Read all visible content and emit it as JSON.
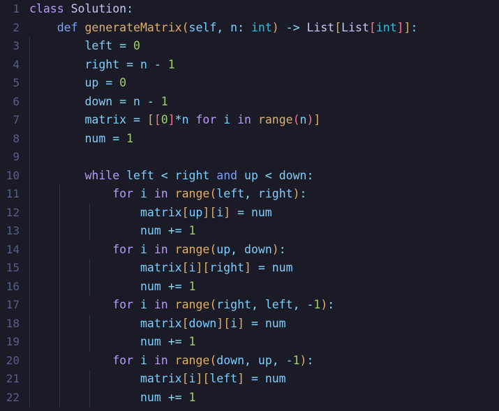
{
  "editor": {
    "language": "python",
    "font_size_px": 16.5,
    "line_height_px": 26.5,
    "active_line": 2,
    "indent_guide_x": [
      42,
      85,
      128,
      171
    ],
    "colors": {
      "background": "#1a1b26",
      "active_line_background": "#1f2233",
      "line_number": "#565f89",
      "indent_guide": "#2f3549",
      "keyword": "#bb9af7",
      "keyword_alt": "#7aa2f7",
      "function": "#e0af68",
      "class_name": "#c0caf5",
      "type": "#2ac3de",
      "variable": "#7dcfff",
      "identifier": "#c0caf5",
      "number": "#9ece6a",
      "operator": "#89ddff",
      "bracket_1": "#e0af68",
      "bracket_2": "#f7768e",
      "bracket_3": "#7aa2f7"
    }
  },
  "lines": [
    {
      "n": "1",
      "indent": 0,
      "text": "class Solution:"
    },
    {
      "n": "2",
      "indent": 0,
      "text": "    def generateMatrix(self, n: int) -> List[List[int]]:"
    },
    {
      "n": "3",
      "indent": 1,
      "text": "        left = 0"
    },
    {
      "n": "4",
      "indent": 1,
      "text": "        right = n - 1"
    },
    {
      "n": "5",
      "indent": 1,
      "text": "        up = 0"
    },
    {
      "n": "6",
      "indent": 1,
      "text": "        down = n - 1"
    },
    {
      "n": "7",
      "indent": 1,
      "text": "        matrix = [[0]*n for i in range(n)]"
    },
    {
      "n": "8",
      "indent": 1,
      "text": "        num = 1"
    },
    {
      "n": "9",
      "indent": 1,
      "text": ""
    },
    {
      "n": "10",
      "indent": 1,
      "text": "        while left < right and up < down:"
    },
    {
      "n": "11",
      "indent": 2,
      "text": "            for i in range(left, right):"
    },
    {
      "n": "12",
      "indent": 3,
      "text": "                matrix[up][i] = num"
    },
    {
      "n": "13",
      "indent": 3,
      "text": "                num += 1"
    },
    {
      "n": "14",
      "indent": 2,
      "text": "            for i in range(up, down):"
    },
    {
      "n": "15",
      "indent": 3,
      "text": "                matrix[i][right] = num"
    },
    {
      "n": "16",
      "indent": 3,
      "text": "                num += 1"
    },
    {
      "n": "17",
      "indent": 2,
      "text": "            for i in range(right, left, -1):"
    },
    {
      "n": "18",
      "indent": 3,
      "text": "                matrix[down][i] = num"
    },
    {
      "n": "19",
      "indent": 3,
      "text": "                num += 1"
    },
    {
      "n": "20",
      "indent": 2,
      "text": "            for i in range(down, up, -1):"
    },
    {
      "n": "21",
      "indent": 3,
      "text": "                matrix[i][left] = num"
    },
    {
      "n": "22",
      "indent": 3,
      "text": "                num += 1"
    }
  ]
}
